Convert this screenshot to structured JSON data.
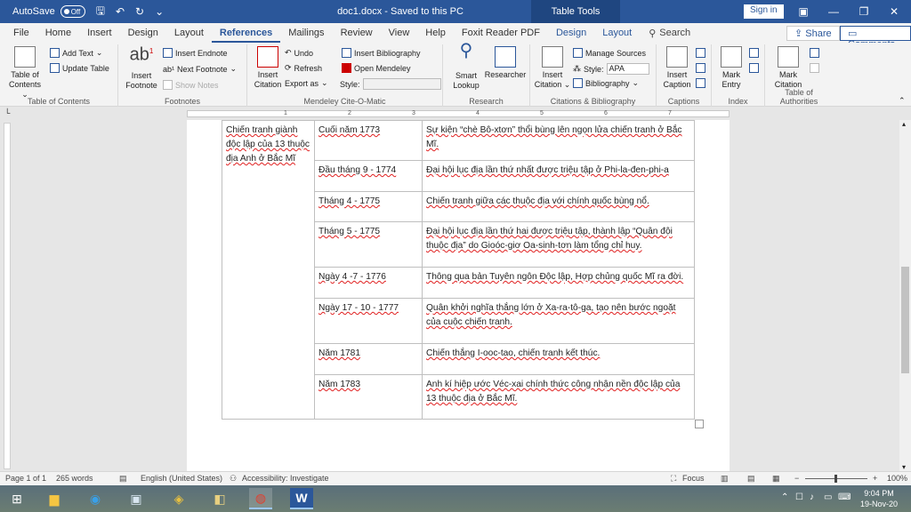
{
  "titlebar": {
    "autosave_label": "AutoSave",
    "autosave_state": "Off",
    "doc_title": "doc1.docx  -  Saved to this PC",
    "contextual_label": "Table Tools",
    "signin_label": "Sign in"
  },
  "tabs": [
    "File",
    "Home",
    "Insert",
    "Design",
    "Layout",
    "References",
    "Mailings",
    "Review",
    "View",
    "Help",
    "Foxit Reader PDF",
    "Design",
    "Layout"
  ],
  "active_tab": "References",
  "search_label": "Search",
  "share_label": "Share",
  "comments_label": "Comments",
  "ribbon": {
    "toc": {
      "label": "Table of Contents",
      "group": "Table of Contents",
      "add_text": "Add Text",
      "update_table": "Update Table"
    },
    "footnotes": {
      "insert_footnote": "Insert Footnote",
      "insert_endnote": "Insert Endnote",
      "next_footnote": "Next Footnote",
      "show_notes": "Show Notes",
      "group": "Footnotes"
    },
    "mendeley": {
      "insert_citation": "Insert Citation",
      "undo": "Undo",
      "refresh": "Refresh",
      "export_as": "Export as",
      "insert_bibliography": "Insert Bibliography",
      "open_mendeley": "Open Mendeley",
      "style_label": "Style:",
      "group": "Mendeley Cite-O-Matic"
    },
    "research": {
      "smart_lookup": "Smart Lookup",
      "researcher": "Researcher",
      "group": "Research"
    },
    "citations": {
      "insert_citation": "Insert Citation",
      "manage_sources": "Manage Sources",
      "style_label": "Style:",
      "style_value": "APA",
      "bibliography": "Bibliography",
      "group": "Citations & Bibliography"
    },
    "captions": {
      "insert_caption": "Insert Caption",
      "group": "Captions"
    },
    "index": {
      "mark_entry": "Mark Entry",
      "group": "Index"
    },
    "authorities": {
      "mark_citation": "Mark Citation",
      "group": "Table of Authorities"
    }
  },
  "ruler_numbers": [
    "1",
    "2",
    "3",
    "4",
    "5",
    "6",
    "7"
  ],
  "table": {
    "first_col": "Chiến tranh giành độc lập của 13 thuộc địa Anh ở Bắc Mĩ",
    "rows": [
      {
        "date": "Cuối năm 1773",
        "event": "Sự kiện “chè Bô-xtơn” thổi bùng lên ngọn lửa chiến tranh ở Bắc Mĩ."
      },
      {
        "date": "Đầu tháng 9 - 1774",
        "event": "Đại hội lục địa lần thứ nhất được triệu tập ở Phi-la-đen-phi-a"
      },
      {
        "date": "Tháng 4 - 1775",
        "event": "Chiến tranh giữa các thuộc địa với chính quốc bùng nổ."
      },
      {
        "date": "Tháng 5 - 1775",
        "event": "Đại hội lục địa lần thứ hai được triệu tập, thành lập “Quân đội thuộc địa” do Gioóc-giơ Oa-sinh-tơn làm tổng chỉ huy."
      },
      {
        "date": "Ngày 4 -7 - 1776",
        "event": "Thông qua bản Tuyên ngôn Độc lập, Hợp chủng quốc Mĩ ra đời."
      },
      {
        "date": "Ngày 17 - 10 - 1777",
        "event": "Quân khởi nghĩa thắng lớn ở Xa-ra-tô-ga, tạo nên bước ngoặt của cuộc chiến tranh."
      },
      {
        "date": "Năm 1781",
        "event": "Chiến thắng I-ooc-tao, chiến tranh kết thúc."
      },
      {
        "date": "Năm 1783",
        "event": "Anh kí hiệp ước Véc-xai chính thức công nhận nền độc lập của 13 thuộc địa ở Bắc Mĩ."
      }
    ]
  },
  "statusbar": {
    "page": "Page 1 of 1",
    "words": "265 words",
    "language": "English (United States)",
    "accessibility": "Accessibility: Investigate",
    "focus": "Focus",
    "zoom": "100%"
  },
  "taskbar": {
    "time": "9:04 PM",
    "date": "19-Nov-20"
  },
  "colors": {
    "accent": "#2b579a",
    "spell_error": "#e02020"
  }
}
